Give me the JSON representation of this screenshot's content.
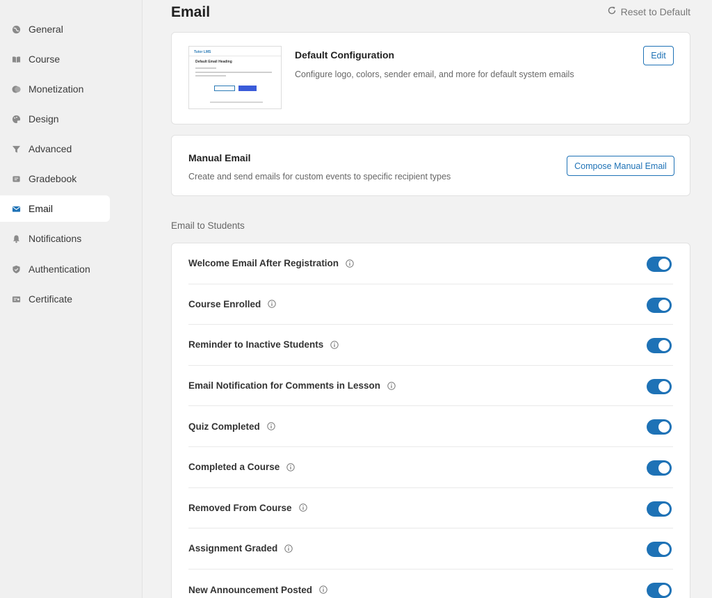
{
  "sidebar": {
    "items": [
      {
        "label": "General",
        "icon": "globe-icon"
      },
      {
        "label": "Course",
        "icon": "book-icon"
      },
      {
        "label": "Monetization",
        "icon": "coins-icon"
      },
      {
        "label": "Design",
        "icon": "palette-icon"
      },
      {
        "label": "Advanced",
        "icon": "filter-icon"
      },
      {
        "label": "Gradebook",
        "icon": "gradebook-icon"
      },
      {
        "label": "Email",
        "icon": "envelope-icon",
        "active": true
      },
      {
        "label": "Notifications",
        "icon": "bell-icon"
      },
      {
        "label": "Authentication",
        "icon": "shield-icon"
      },
      {
        "label": "Certificate",
        "icon": "certificate-icon"
      }
    ]
  },
  "header": {
    "title": "Email",
    "reset_label": "Reset to Default"
  },
  "default_config": {
    "title": "Default Configuration",
    "description": "Configure logo, colors, sender email, and more for default system emails",
    "edit_label": "Edit",
    "preview": {
      "logo_text": "Tutor LMS",
      "heading": "Default Email Heading"
    }
  },
  "manual_email": {
    "title": "Manual Email",
    "description": "Create and send emails for custom events to specific recipient types",
    "compose_label": "Compose Manual Email"
  },
  "students_section": {
    "label": "Email to Students",
    "rows": [
      {
        "label": "Welcome Email After Registration",
        "enabled": true
      },
      {
        "label": "Course Enrolled",
        "enabled": true
      },
      {
        "label": "Reminder to Inactive Students",
        "enabled": true
      },
      {
        "label": "Email Notification for Comments in Lesson",
        "enabled": true
      },
      {
        "label": "Quiz Completed",
        "enabled": true
      },
      {
        "label": "Completed a Course",
        "enabled": true
      },
      {
        "label": "Removed From Course",
        "enabled": true
      },
      {
        "label": "Assignment Graded",
        "enabled": true
      },
      {
        "label": "New Announcement Posted",
        "enabled": true
      }
    ]
  },
  "colors": {
    "accent": "#1e72b6",
    "sidebar_bg": "#f0f0f0",
    "page_bg": "#f2f2f2"
  }
}
